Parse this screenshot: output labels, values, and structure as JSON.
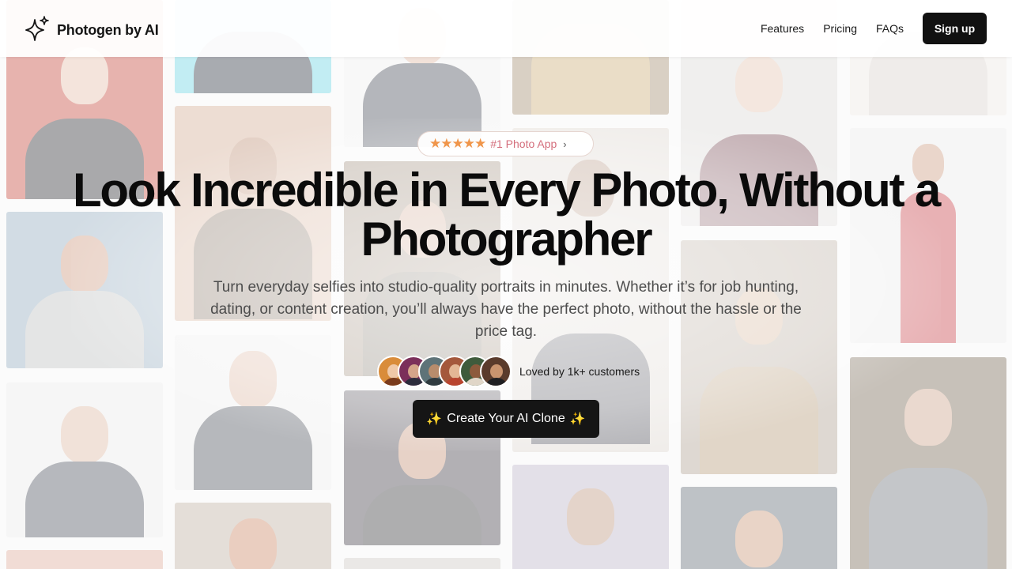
{
  "brand": {
    "name": "Photogen by AI",
    "icon": "sparkles-icon"
  },
  "nav": {
    "links": [
      "Features",
      "Pricing",
      "FAQs"
    ],
    "signup_label": "Sign up"
  },
  "hero": {
    "badge": {
      "stars": "★★★★★",
      "text": "#1 Photo App",
      "chevron": "›",
      "star_color": "#f0964b",
      "text_color": "#d46e7c"
    },
    "headline": "Look Incredible in Every Photo, Without a Photographer",
    "subtext": "Turn everyday selfies into studio-quality portraits in minutes. Whether it’s for job hunting, dating, or content creation, you’ll always have the perfect photo, without the hassle or the price tag.",
    "social_proof": {
      "text": "Loved by 1k+ customers",
      "avatar_count": 6
    },
    "cta": {
      "sparkle_left": "✨",
      "label": "Create Your AI Clone",
      "sparkle_right": "✨"
    }
  },
  "colors": {
    "primary_dark": "#111111",
    "background": "#f4f4f4"
  }
}
